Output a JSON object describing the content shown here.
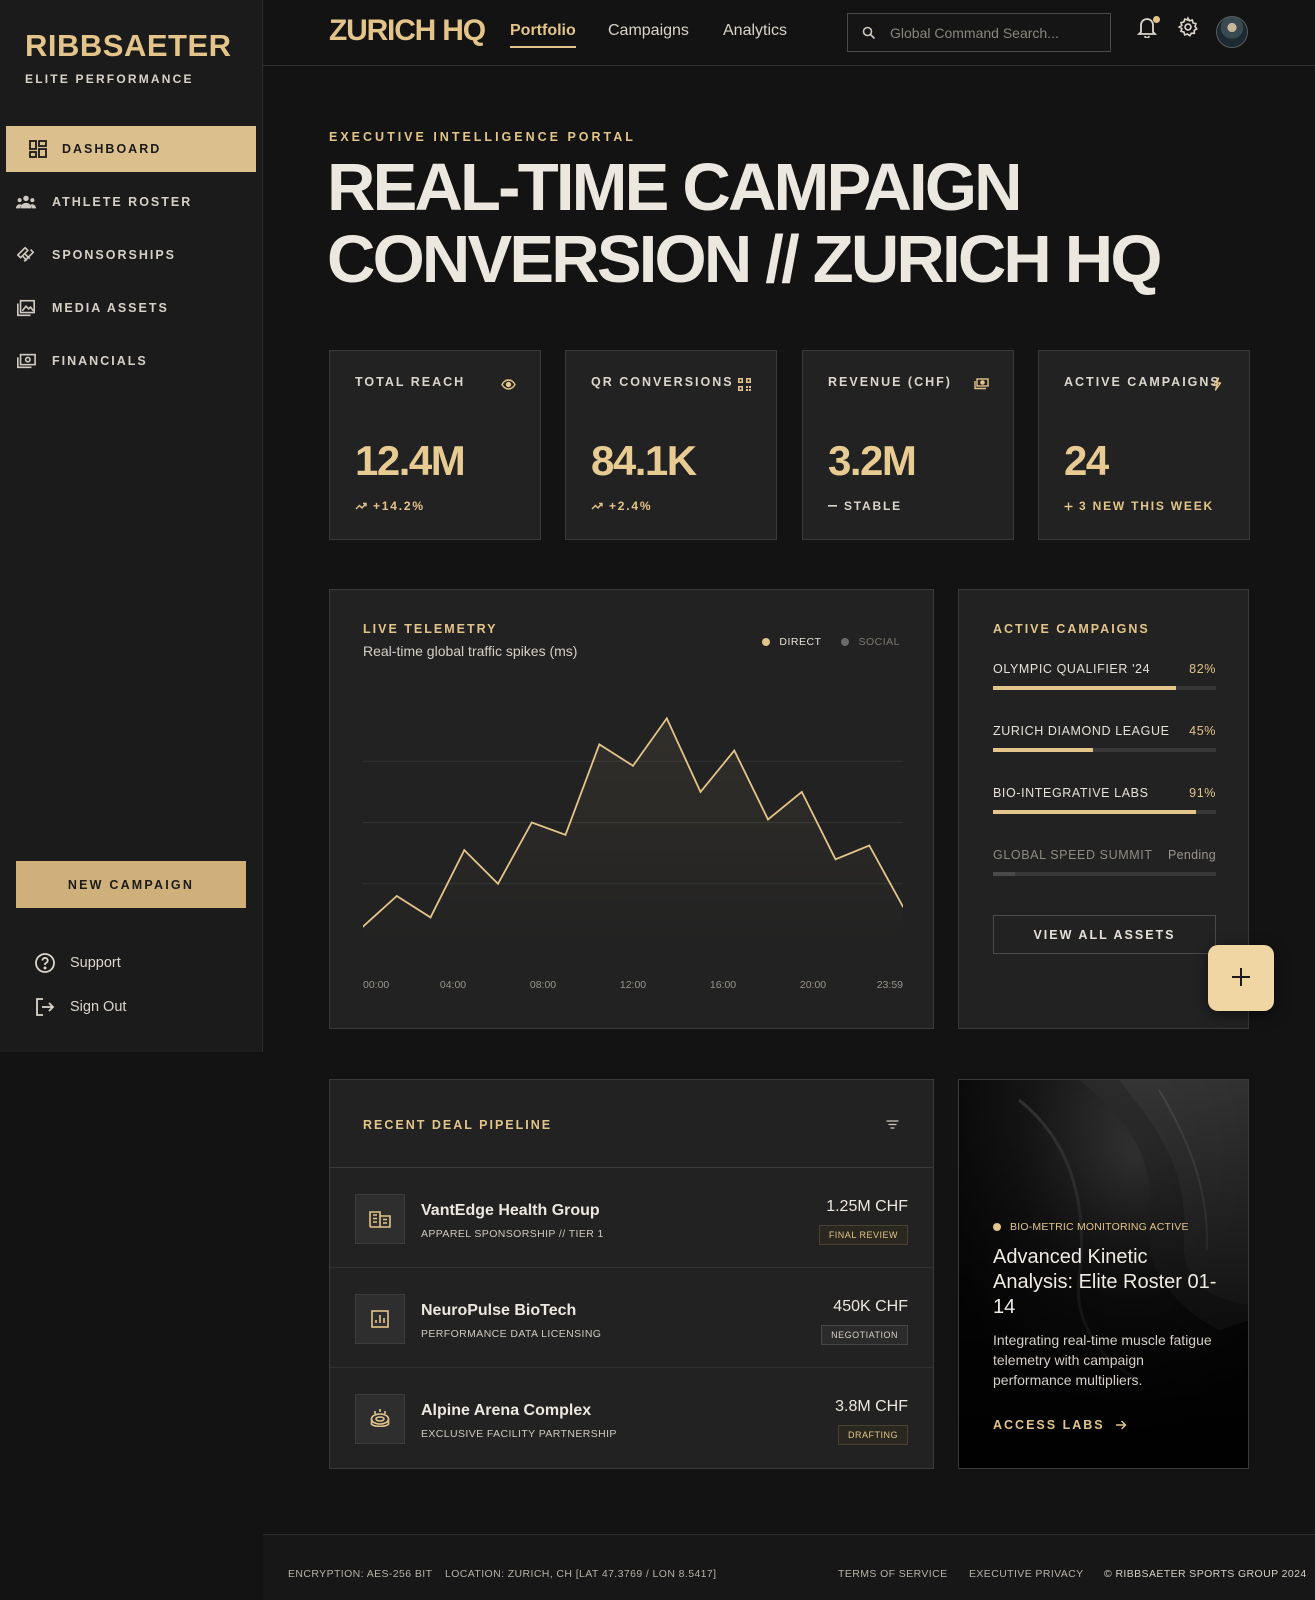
{
  "brand": {
    "name": "RIBBSAETER",
    "tagline": "ELITE PERFORMANCE"
  },
  "sidebar": {
    "items": [
      {
        "label": "DASHBOARD",
        "icon": "dashboard-icon",
        "active": true
      },
      {
        "label": "ATHLETE ROSTER",
        "icon": "group-icon",
        "active": false
      },
      {
        "label": "SPONSORSHIPS",
        "icon": "handshake-icon",
        "active": false
      },
      {
        "label": "MEDIA ASSETS",
        "icon": "image-library-icon",
        "active": false
      },
      {
        "label": "FINANCIALS",
        "icon": "payments-icon",
        "active": false
      }
    ],
    "new_campaign_label": "NEW CAMPAIGN",
    "support_label": "Support",
    "signout_label": "Sign Out"
  },
  "header": {
    "title": "ZURICH HQ",
    "tabs": [
      {
        "label": "Portfolio",
        "active": true
      },
      {
        "label": "Campaigns",
        "active": false
      },
      {
        "label": "Analytics",
        "active": false
      }
    ],
    "search_placeholder": "Global Command Search..."
  },
  "hero": {
    "eyebrow": "EXECUTIVE INTELLIGENCE PORTAL",
    "title_line1": "REAL-TIME CAMPAIGN",
    "title_line2": "CONVERSION // ZURICH HQ"
  },
  "kpis": [
    {
      "label": "TOTAL REACH",
      "value": "12.4M",
      "delta": "+14.2%",
      "icon": "eye-icon",
      "trend": "up"
    },
    {
      "label": "QR CONVERSIONS",
      "value": "84.1K",
      "delta": "+2.4%",
      "icon": "qr-code-icon",
      "trend": "up"
    },
    {
      "label": "REVENUE (CHF)",
      "value": "3.2M",
      "delta": "STABLE",
      "icon": "cash-icon",
      "trend": "flat"
    },
    {
      "label": "ACTIVE CAMPAIGNS",
      "value": "24",
      "delta": "3 NEW THIS WEEK",
      "icon": "bolt-icon",
      "trend": "new"
    }
  ],
  "telemetry": {
    "title": "LIVE TELEMETRY",
    "subtitle": "Real-time global traffic spikes (ms)",
    "legend": [
      {
        "label": "DIRECT",
        "color": "#e3c48a"
      },
      {
        "label": "SOCIAL",
        "color": "#6b6b6b"
      }
    ]
  },
  "chart_data": {
    "type": "line",
    "x_ticks": [
      "00:00",
      "04:00",
      "08:00",
      "12:00",
      "16:00",
      "20:00",
      "23:59"
    ],
    "series": [
      {
        "name": "DIRECT",
        "values": [
          12,
          32,
          18,
          62,
          40,
          80,
          72,
          131,
          117,
          148,
          100,
          127,
          82,
          100,
          56,
          65,
          25
        ]
      }
    ],
    "ylim": [
      0,
      160
    ],
    "grid": true,
    "legend_position": "top-right"
  },
  "active_campaigns": {
    "title": "ACTIVE CAMPAIGNS",
    "items": [
      {
        "name": "OLYMPIC QUALIFIER '24",
        "status": "82%",
        "progress": 82
      },
      {
        "name": "ZURICH DIAMOND LEAGUE",
        "status": "45%",
        "progress": 45
      },
      {
        "name": "BIO-INTEGRATIVE LABS",
        "status": "91%",
        "progress": 91
      },
      {
        "name": "GLOBAL SPEED SUMMIT",
        "status": "Pending",
        "progress": 10
      }
    ],
    "view_all_label": "VIEW ALL ASSETS"
  },
  "pipeline": {
    "title": "RECENT DEAL PIPELINE",
    "deals": [
      {
        "name": "VantEdge Health Group",
        "subtitle": "APPAREL SPONSORSHIP // TIER 1",
        "amount": "1.25M CHF",
        "status": "FINAL REVIEW",
        "icon": "building-icon"
      },
      {
        "name": "NeuroPulse BioTech",
        "subtitle": "PERFORMANCE DATA LICENSING",
        "amount": "450K CHF",
        "status": "NEGOTIATION",
        "icon": "analytics-icon"
      },
      {
        "name": "Alpine Arena Complex",
        "subtitle": "EXCLUSIVE FACILITY PARTNERSHIP",
        "amount": "3.8M CHF",
        "status": "DRAFTING",
        "icon": "stadium-icon"
      }
    ]
  },
  "feature": {
    "tag": "BIO-METRIC MONITORING ACTIVE",
    "title": "Advanced Kinetic Analysis: Elite Roster 01-14",
    "text": "Integrating real-time muscle fatigue telemetry with campaign performance multipliers.",
    "link_label": "ACCESS LABS"
  },
  "footer": {
    "encryption": "ENCRYPTION: AES-256 BIT",
    "location": "LOCATION: ZURICH, CH [LAT 47.3769 / LON 8.5417]",
    "terms": "TERMS OF SERVICE",
    "privacy": "EXECUTIVE PRIVACY",
    "copyright": "© RIBBSAETER SPORTS GROUP 2024"
  },
  "colors": {
    "accent": "#e3c48a",
    "background": "#131313",
    "panel": "#222222"
  }
}
